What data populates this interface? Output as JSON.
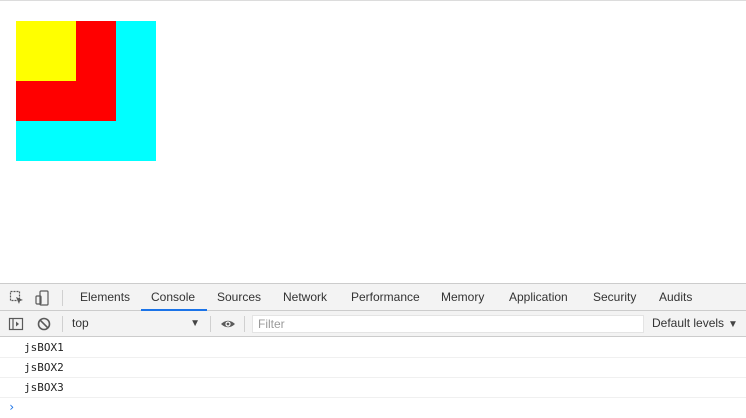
{
  "page": {
    "boxes": [
      {
        "id": "jsBOX3",
        "color": "#00ffff"
      },
      {
        "id": "jsBOX2",
        "color": "#ff0000"
      },
      {
        "id": "jsBOX1",
        "color": "#ffff00"
      }
    ]
  },
  "devtools": {
    "tabs": [
      "Elements",
      "Console",
      "Sources",
      "Network",
      "Performance",
      "Memory",
      "Application",
      "Security",
      "Audits"
    ],
    "active_tab": "Console",
    "icons": {
      "inspect": "inspect-element-icon",
      "device": "device-toolbar-icon",
      "sidebar": "show-sidebar-icon",
      "clear": "clear-console-icon",
      "eye": "live-expression-icon"
    },
    "accent": "#1a73e8"
  },
  "console": {
    "context": "top",
    "filter_placeholder": "Filter",
    "levels": "Default levels",
    "logs": [
      "jsBOX1",
      "jsBOX2",
      "jsBOX3"
    ],
    "prompt": "›"
  }
}
